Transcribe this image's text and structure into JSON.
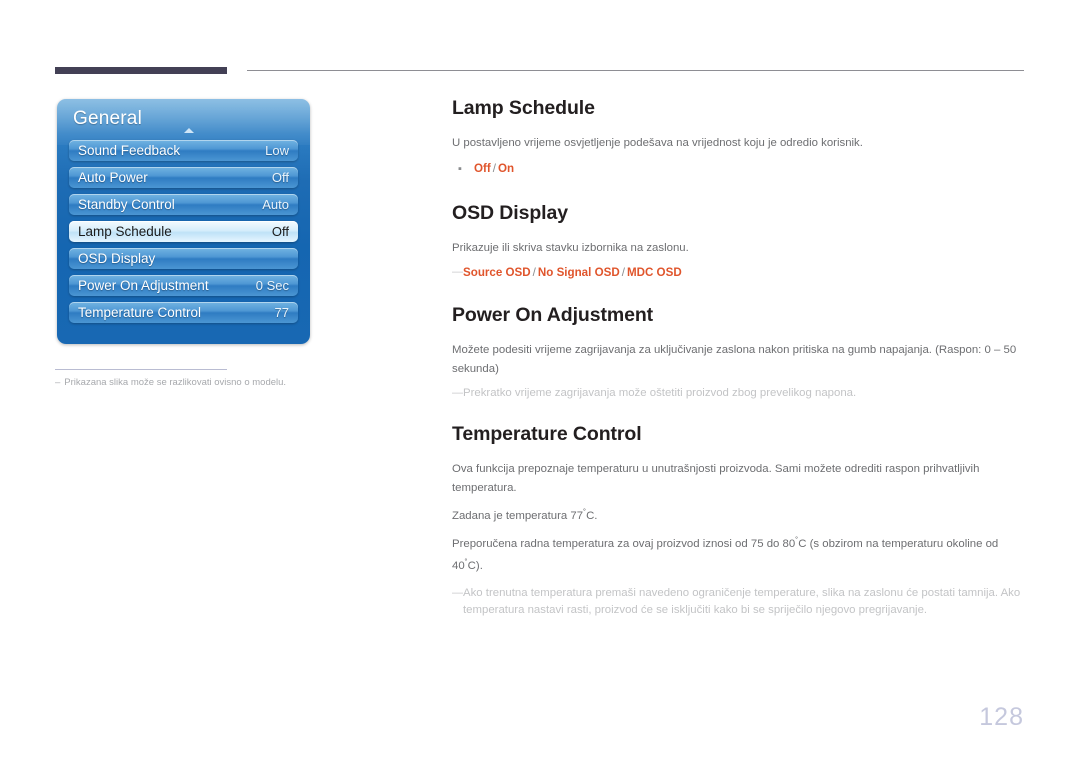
{
  "osd": {
    "title": "General",
    "scroll_indicator": "up-arrow",
    "rows": [
      {
        "label": "Sound Feedback",
        "value": "Low",
        "selected": false
      },
      {
        "label": "Auto Power",
        "value": "Off",
        "selected": false
      },
      {
        "label": "Standby Control",
        "value": "Auto",
        "selected": false
      },
      {
        "label": "Lamp Schedule",
        "value": "Off",
        "selected": true
      },
      {
        "label": "OSD Display",
        "value": "",
        "selected": false
      },
      {
        "label": "Power On Adjustment",
        "value": "0 Sec",
        "selected": false
      },
      {
        "label": "Temperature Control",
        "value": "77",
        "selected": false
      }
    ]
  },
  "footnote_left": {
    "dash": "‒",
    "text": "Prikazana slika može se razlikovati ovisno o modelu."
  },
  "sections": [
    {
      "heading": "Lamp Schedule",
      "body": "U postavljeno vrijeme osvjetljenje podešava na vrijednost koju je odredio korisnik.",
      "bullet": {
        "dot": "▪",
        "options": [
          "Off",
          "On"
        ],
        "separator": "/"
      }
    },
    {
      "heading": "OSD Display",
      "body": "Prikazuje ili skriva stavku izbornika na zaslonu.",
      "dash_red": {
        "dash": "―",
        "options": [
          "Source OSD",
          "No Signal OSD",
          "MDC OSD"
        ],
        "separator": "/"
      }
    },
    {
      "heading": "Power On Adjustment",
      "body": "Možete podesiti vrijeme zagrijavanja za uključivanje zaslona nakon pritiska na gumb napajanja. (Raspon: 0 – 50 sekunda)",
      "dash_note": {
        "dash": "―",
        "text": "Prekratko vrijeme zagrijavanja može oštetiti proizvod zbog prevelikog napona."
      }
    },
    {
      "heading": "Temperature Control",
      "body1": "Ova funkcija prepoznaje temperaturu u unutrašnjosti proizvoda. Sami možete odrediti raspon prihvatljivih temperatura.",
      "body2_pre": "Zadana je temperatura 77",
      "body2_deg": "˚",
      "body2_post": "C.",
      "body3_a": "Preporučena radna temperatura za ovaj proizvod iznosi od 75 do 80",
      "body3_deg1": "˚",
      "body3_b": "C (s obzirom na temperaturu okoline od 40",
      "body3_deg2": "˚",
      "body3_c": "C).",
      "dash_note": {
        "dash": "―",
        "text": "Ako trenutna temperatura premaši navedeno ograničenje temperature, slika na zaslonu će postati tamnija. Ako temperatura nastavi rasti, proizvod će se isključiti kako bi se spriječilo njegovo pregrijavanje."
      }
    }
  ],
  "page_number": "128",
  "colors": {
    "accent_red": "#e0552c",
    "panel_blue": "#1e6cb4",
    "top_bar_dark": "#434055",
    "page_number": "#c5c8dd"
  }
}
